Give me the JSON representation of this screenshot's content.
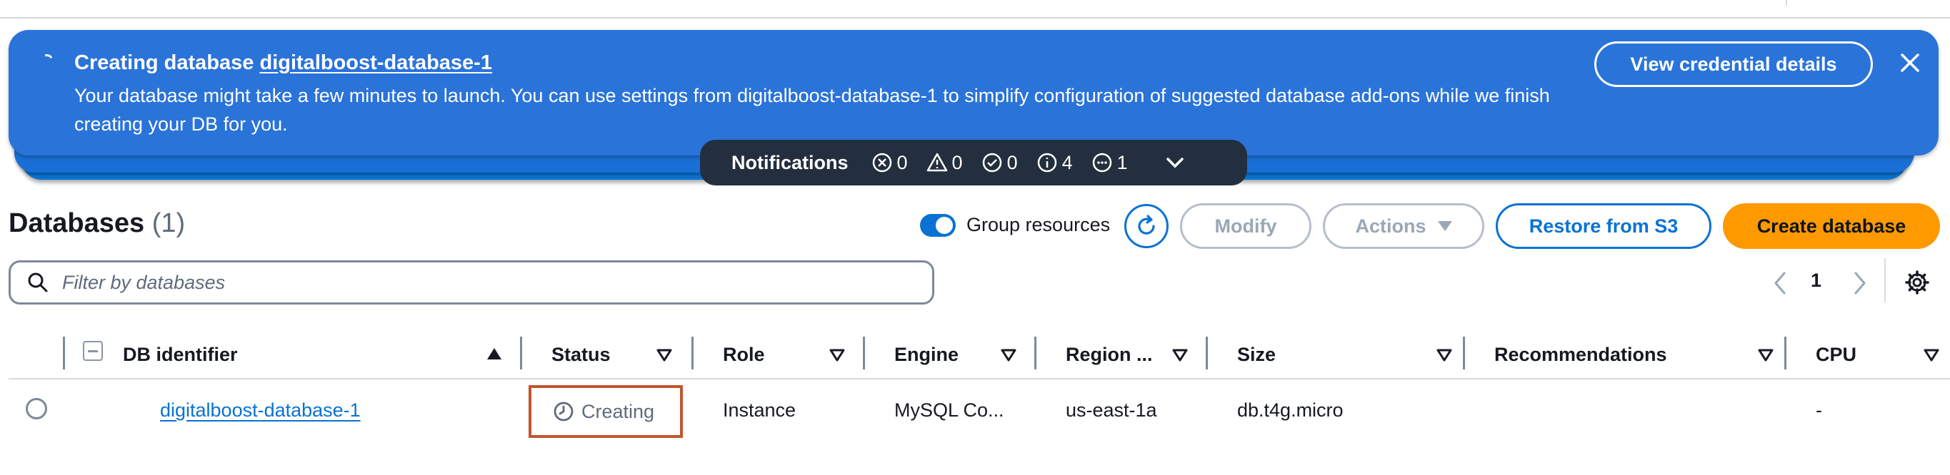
{
  "flash": {
    "title_prefix": "Creating database",
    "title_link": "digitalboost-database-1",
    "message": "Your database might take a few minutes to launch. You can use settings from digitalboost-database-1 to simplify configuration of suggested database add-ons while we finish creating your DB for you.",
    "credential_button": "View credential details"
  },
  "notifications": {
    "label": "Notifications",
    "errors": "0",
    "warnings": "0",
    "success": "0",
    "info": "4",
    "in_progress": "1"
  },
  "databases": {
    "title": "Databases",
    "count": "(1)",
    "group_resources_label": "Group resources",
    "group_resources_on": true,
    "modify_label": "Modify",
    "actions_label": "Actions",
    "restore_label": "Restore from S3",
    "create_label": "Create database",
    "filter_placeholder": "Filter by databases",
    "page": "1"
  },
  "table": {
    "columns": {
      "db_identifier": "DB identifier",
      "status": "Status",
      "role": "Role",
      "engine": "Engine",
      "region": "Region ...",
      "size": "Size",
      "recommendations": "Recommendations",
      "cpu": "CPU"
    },
    "rows": [
      {
        "db_identifier": "digitalboost-database-1",
        "status": "Creating",
        "role": "Instance",
        "engine": "MySQL Co...",
        "region": "us-east-1a",
        "size": "db.t4g.micro",
        "recommendations": "",
        "cpu": "-"
      }
    ]
  },
  "colors": {
    "flash_blue": "#2a73d9",
    "link_blue": "#0972d3",
    "primary_orange": "#ff9900",
    "notification_dark": "#232f3e",
    "status_highlight": "#c2562d"
  }
}
